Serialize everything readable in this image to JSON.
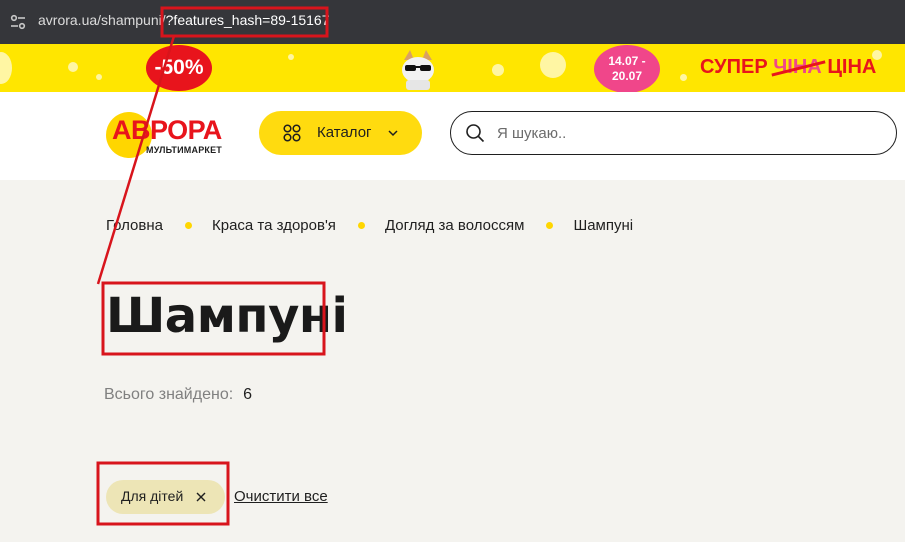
{
  "browser": {
    "url_base": "avrora.ua/shampuni/",
    "url_query": "?features_hash=89-15167"
  },
  "promo": {
    "sale_text": "-50%",
    "dates_start": "14.07 -",
    "dates_end": "20.07",
    "super_word": "СУПЕР",
    "strike_word": "ЧІНА",
    "price_word": "ЦІНА"
  },
  "header": {
    "logo_name": "АВРОРА",
    "logo_sub": "МУЛЬТИМАРКЕТ",
    "catalog_label": "Каталог",
    "search_placeholder": "Я шукаю.."
  },
  "breadcrumb": [
    "Головна",
    "Краса та здоров'я",
    "Догляд за волоссям",
    "Шампуні"
  ],
  "page": {
    "title": "Шампуні",
    "found_label": "Всього знайдено:",
    "found_count": "6"
  },
  "filters": {
    "active_chip": "Для дітей",
    "clear_label": "Очистити все"
  },
  "colors": {
    "brand_yellow": "#ffd600",
    "brand_red": "#e8141c",
    "annotation_red": "#d8141c"
  }
}
